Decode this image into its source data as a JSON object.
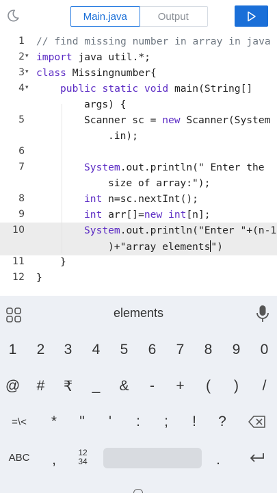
{
  "header": {
    "tabs": [
      {
        "label": "Main.java",
        "active": true
      },
      {
        "label": "Output",
        "active": false
      }
    ],
    "theme_icon": "moon-icon",
    "run_icon": "play-icon",
    "accent": "#1a6fd8"
  },
  "editor": {
    "active_line": "10",
    "lines": [
      {
        "num": "1",
        "text": "// find missing number in array in java"
      },
      {
        "num": "2",
        "text": "import java util.*;"
      },
      {
        "num": "3",
        "text": "class Missingnumber{"
      },
      {
        "num": "4",
        "text": "public static void main(String[]",
        "wrap": "args) {"
      },
      {
        "num": "5",
        "text": "Scanner sc = new Scanner(System",
        "wrap": ".in);"
      },
      {
        "num": "6",
        "text": ""
      },
      {
        "num": "7",
        "text": "System.out.println(\" Enter the",
        "wrap": "size of array:\");"
      },
      {
        "num": "8",
        "text": "int n=sc.nextInt();"
      },
      {
        "num": "9",
        "text": "int arr[]=new int[n];"
      },
      {
        "num": "10",
        "text": "System.out.println(\"Enter \"+(n-1",
        "wrap": ")+\"array elements\")"
      },
      {
        "num": "11",
        "text": "}"
      },
      {
        "num": "12",
        "text": "}"
      }
    ]
  },
  "keyboard": {
    "suggestion": "elements",
    "row_numbers": [
      "1",
      "2",
      "3",
      "4",
      "5",
      "6",
      "7",
      "8",
      "9",
      "0"
    ],
    "row_symbols1": [
      "@",
      "#",
      "₹",
      "_",
      "&",
      "-",
      "+",
      "(",
      ")",
      "/"
    ],
    "row_symbols2": [
      "=\\<",
      "*",
      "\"",
      "'",
      ":",
      ";",
      "!",
      "?"
    ],
    "abc_label": "ABC",
    "comma_label": ",",
    "numpad_label_top": "12",
    "numpad_label_bottom": "34",
    "period_label": ".",
    "bg": "#edf0f5"
  }
}
